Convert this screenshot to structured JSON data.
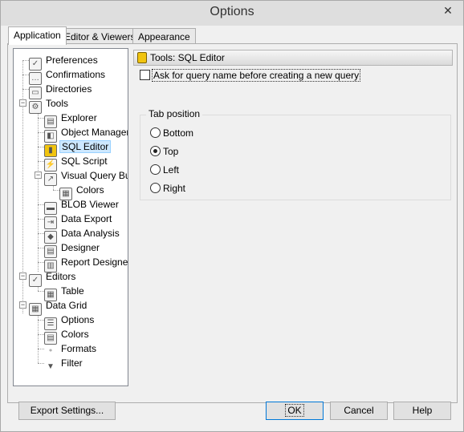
{
  "window": {
    "title": "Options",
    "close_glyph": "✕"
  },
  "tabs": [
    {
      "label": "Application",
      "active": true
    },
    {
      "label": "Editor & Viewers",
      "active": false
    },
    {
      "label": "Appearance",
      "active": false
    }
  ],
  "tree": {
    "items": [
      {
        "label": "Preferences",
        "icon": "preferences-icon",
        "glyph": "✓"
      },
      {
        "label": "Confirmations",
        "icon": "confirmations-icon",
        "glyph": "…"
      },
      {
        "label": "Directories",
        "icon": "directories-icon",
        "glyph": "▭"
      },
      {
        "label": "Tools",
        "icon": "tools-icon",
        "glyph": "⚙"
      },
      {
        "label": "Explorer",
        "icon": "explorer-icon",
        "glyph": "▤"
      },
      {
        "label": "Object Manager",
        "icon": "object-manager-icon",
        "glyph": "◧"
      },
      {
        "label": "SQL Editor",
        "icon": "sql-editor-icon",
        "glyph": "▮"
      },
      {
        "label": "SQL Script",
        "icon": "sql-script-icon",
        "glyph": "⚡"
      },
      {
        "label": "Visual Query Buil",
        "icon": "visual-query-builder-icon",
        "glyph": "↗"
      },
      {
        "label": "Colors",
        "icon": "colors-grid-icon",
        "glyph": "▦"
      },
      {
        "label": "BLOB Viewer",
        "icon": "blob-viewer-icon",
        "glyph": "▬"
      },
      {
        "label": "Data Export",
        "icon": "data-export-icon",
        "glyph": "⇥"
      },
      {
        "label": "Data Analysis",
        "icon": "data-analysis-icon",
        "glyph": "◆"
      },
      {
        "label": "Designer",
        "icon": "designer-icon",
        "glyph": "▤"
      },
      {
        "label": "Report Designer",
        "icon": "report-designer-icon",
        "glyph": "▥"
      },
      {
        "label": "Editors",
        "icon": "editors-icon",
        "glyph": "✓"
      },
      {
        "label": "Table",
        "icon": "table-icon",
        "glyph": "▦"
      },
      {
        "label": "Data Grid",
        "icon": "data-grid-icon",
        "glyph": "▦"
      },
      {
        "label": "Options",
        "icon": "grid-options-icon",
        "glyph": "☰"
      },
      {
        "label": "Colors",
        "icon": "grid-colors-icon",
        "glyph": "▤"
      },
      {
        "label": "Formats",
        "icon": "formats-icon",
        "glyph": "⁺"
      },
      {
        "label": "Filter",
        "icon": "filter-icon",
        "glyph": "▼"
      }
    ],
    "selected": "SQL Editor",
    "expander_minus": "−"
  },
  "panel": {
    "header": "Tools: SQL Editor",
    "checkbox_label": "Ask for query name before creating a new query",
    "checkbox_checked": false,
    "group_title": "Tab position",
    "radios": [
      {
        "label": "Bottom",
        "checked": false
      },
      {
        "label": "Top",
        "checked": true
      },
      {
        "label": "Left",
        "checked": false
      },
      {
        "label": "Right",
        "checked": false
      }
    ]
  },
  "buttons": {
    "export": "Export Settings...",
    "ok": "OK",
    "cancel": "Cancel",
    "help": "Help"
  }
}
